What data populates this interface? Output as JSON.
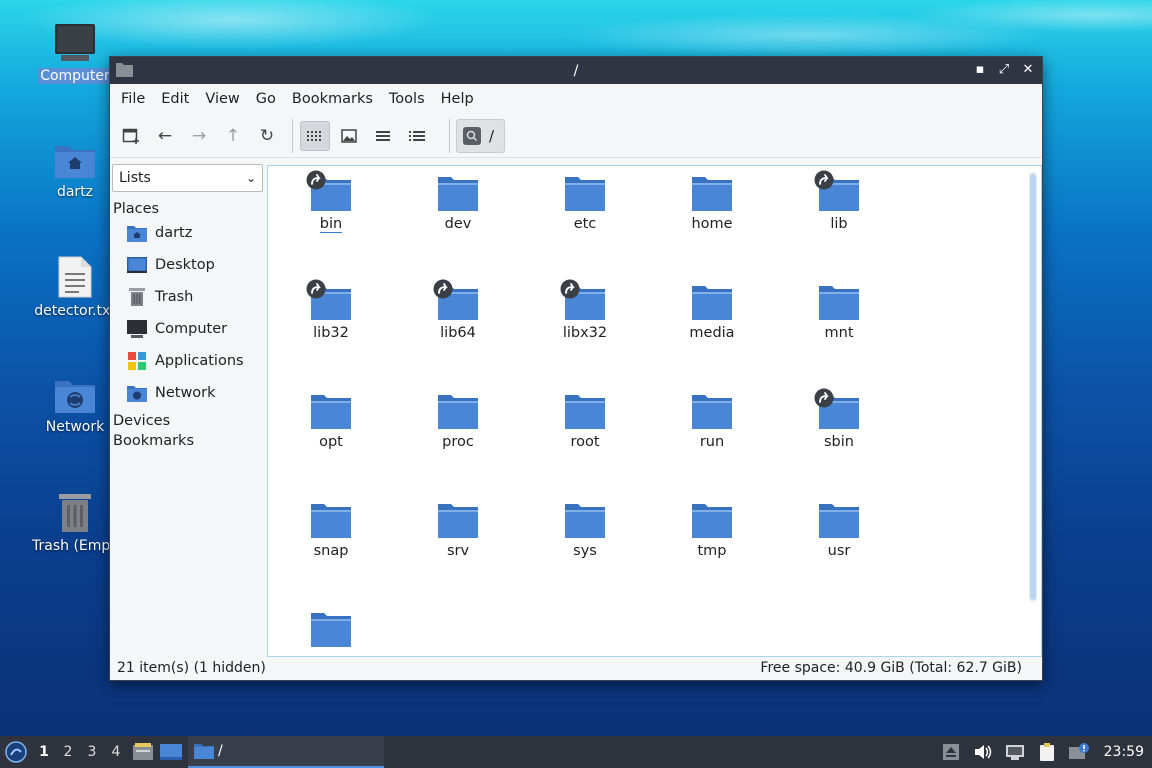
{
  "desktop": {
    "icons": [
      {
        "label": "Computer"
      },
      {
        "label": "dartz"
      },
      {
        "label": "detector.txt"
      },
      {
        "label": "Network"
      },
      {
        "label": "Trash (Empty)"
      }
    ]
  },
  "window": {
    "title": "/",
    "controls": {
      "minimize": "▪",
      "maximize": "⤢",
      "close": "✕"
    }
  },
  "menu": [
    "File",
    "Edit",
    "View",
    "Go",
    "Bookmarks",
    "Tools",
    "Help"
  ],
  "toolbar": {
    "path": "/"
  },
  "sidebar": {
    "mode": "Lists",
    "places_header": "Places",
    "places": [
      "dartz",
      "Desktop",
      "Trash",
      "Computer",
      "Applications",
      "Network"
    ],
    "devices_header": "Devices",
    "bookmarks_header": "Bookmarks"
  },
  "files": [
    {
      "name": "bin",
      "link": true
    },
    {
      "name": "dev",
      "link": false
    },
    {
      "name": "etc",
      "link": false
    },
    {
      "name": "home",
      "link": false
    },
    {
      "name": "lib",
      "link": true
    },
    {
      "name": "lib32",
      "link": true
    },
    {
      "name": "lib64",
      "link": true
    },
    {
      "name": "libx32",
      "link": true
    },
    {
      "name": "media",
      "link": false
    },
    {
      "name": "mnt",
      "link": false
    },
    {
      "name": "opt",
      "link": false
    },
    {
      "name": "proc",
      "link": false
    },
    {
      "name": "root",
      "link": false
    },
    {
      "name": "run",
      "link": false
    },
    {
      "name": "sbin",
      "link": true
    },
    {
      "name": "snap",
      "link": false
    },
    {
      "name": "srv",
      "link": false
    },
    {
      "name": "sys",
      "link": false
    },
    {
      "name": "tmp",
      "link": false
    },
    {
      "name": "usr",
      "link": false
    },
    {
      "name": "",
      "link": false
    }
  ],
  "status": {
    "left": "21 item(s) (1 hidden)",
    "right": "Free space: 40.9 GiB (Total: 62.7 GiB)"
  },
  "taskbar": {
    "workspaces": [
      "1",
      "2",
      "3",
      "4"
    ],
    "task_label": "/",
    "clock": "23:59"
  },
  "colors": {
    "folder": "#4a86d6",
    "folder_tab": "#3a72c2",
    "titlebar": "#2f3542",
    "taskbar": "#2e333d"
  }
}
